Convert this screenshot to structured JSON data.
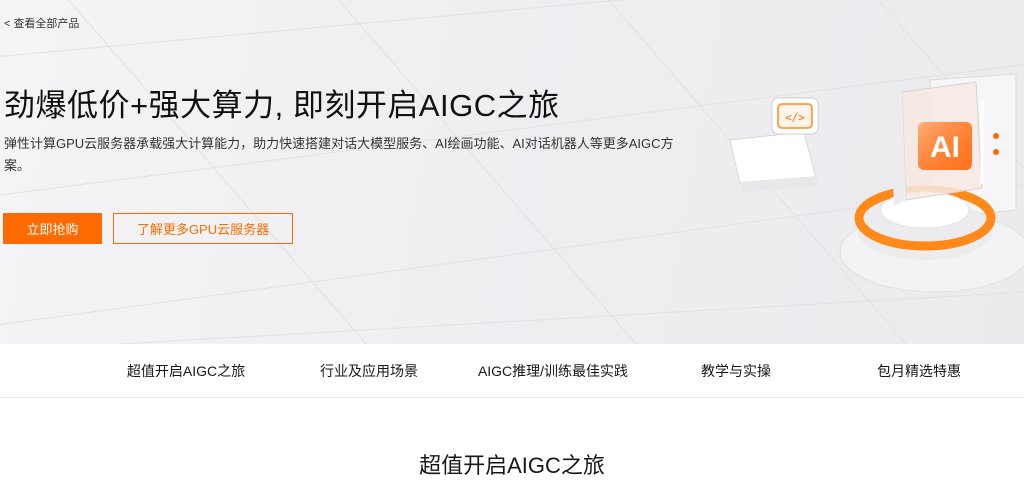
{
  "nav": {
    "back_chevron": "<",
    "back_label": "查看全部产品"
  },
  "hero": {
    "title": "劲爆低价+强大算力, 即刻开启AIGC之旅",
    "description": "弹性计算GPU云服务器承载强大计算能力，助力快速搭建对话大模型服务、AI绘画功能、AI对话机器人等更多AIGC方案。",
    "primary_button": "立即抢购",
    "secondary_button": "了解更多GPU云服务器",
    "art": {
      "code_icon": "</>",
      "ai_badge": "AI",
      "icon_name": "ai-cube-illustration"
    }
  },
  "tabs": [
    {
      "label": "超值开启AIGC之旅"
    },
    {
      "label": "行业及应用场景"
    },
    {
      "label": "AIGC推理/训练最佳实践"
    },
    {
      "label": "教学与实操"
    },
    {
      "label": "包月精选特惠"
    }
  ],
  "section": {
    "title": "超值开启AIGC之旅"
  },
  "colors": {
    "accent": "#ff6a00",
    "hero_bg": "#efeff2",
    "text": "#181818"
  }
}
